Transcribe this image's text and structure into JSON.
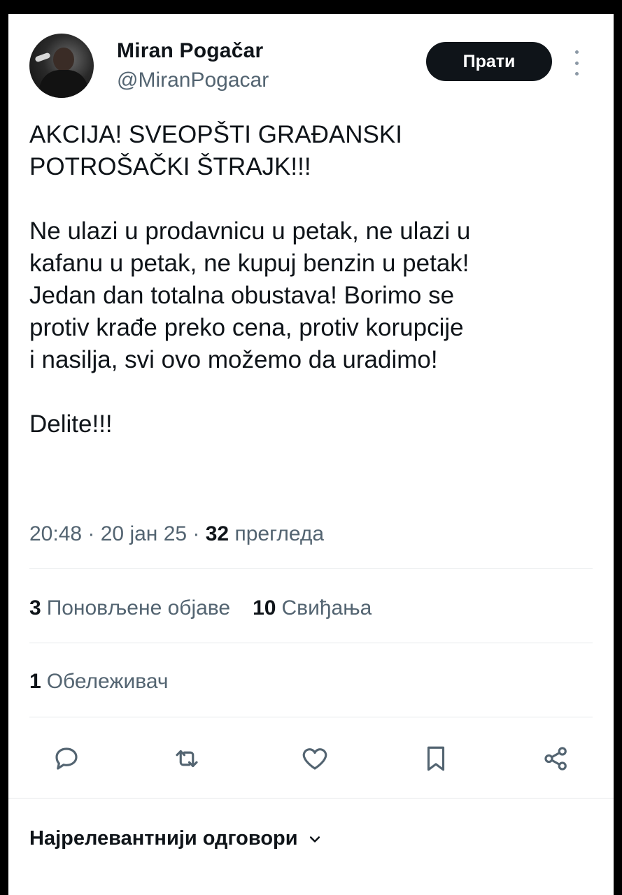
{
  "author": {
    "name": "Miran Pogačar",
    "handle": "@MiranPogacar"
  },
  "header": {
    "follow_label": "Прати",
    "more_icon": "more-vertical-icon"
  },
  "tweet": {
    "lines": [
      "AKCIJA! SVEOPŠTI GRAĐANSKI",
      "POTROŠAČKI ŠTRAJK!!!",
      "",
      "Ne ulazi u prodavnicu u petak, ne ulazi u",
      "kafanu u petak, ne kupuj benzin u petak!",
      "Jedan dan totalna obustava! Borimo se",
      "protiv krađe preko cena, protiv korupcije",
      "i nasilja, svi ovo možemo da uradimo!",
      "",
      "Delite!!!"
    ]
  },
  "meta": {
    "time": "20:48",
    "separator": " · ",
    "date": "20 јан 25",
    "views_count": "32",
    "views_label": "прегледа"
  },
  "stats": {
    "reposts_count": "3",
    "reposts_label": "Поновљене објаве",
    "likes_count": "10",
    "likes_label": "Свиђања",
    "bookmarks_count": "1",
    "bookmarks_label": "Обележивач"
  },
  "actions": [
    {
      "icon": "reply-icon"
    },
    {
      "icon": "repost-icon"
    },
    {
      "icon": "like-icon"
    },
    {
      "icon": "bookmark-icon"
    },
    {
      "icon": "share-icon"
    }
  ],
  "replies": {
    "label": "Најрелевантнији одговори",
    "icon": "chevron-down-icon"
  },
  "colors": {
    "text": "#0f1419",
    "secondary": "#536471",
    "divider": "#e6e9eb",
    "button_bg": "#0f1419",
    "background": "#ffffff"
  }
}
